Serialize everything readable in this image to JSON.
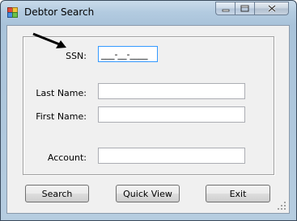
{
  "window": {
    "title": "Debtor Search",
    "title_icon": "form-app-icon",
    "caption_buttons": [
      "minimize-icon",
      "maximize-icon",
      "close-icon"
    ]
  },
  "form": {
    "ssn": {
      "label": "SSN:",
      "value": "___-__-____"
    },
    "last_name": {
      "label": "Last Name:",
      "value": ""
    },
    "first_name": {
      "label": "First Name:",
      "value": ""
    },
    "account": {
      "label": "Account:",
      "value": ""
    }
  },
  "buttons": {
    "search": "Search",
    "quick_view": "Quick View",
    "exit": "Exit"
  },
  "annotation": {
    "icon": "arrow-icon",
    "color": "#000000"
  },
  "colors": {
    "title_bar": "#b3cbe0",
    "client_bg": "#f0f0f0",
    "focus_border": "#3399ff"
  }
}
